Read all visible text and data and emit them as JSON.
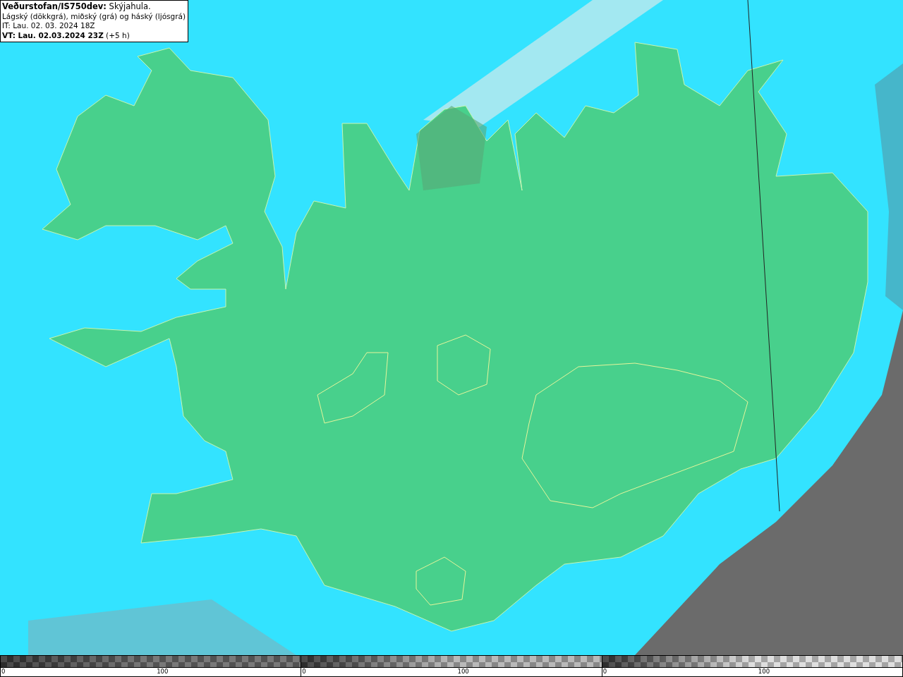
{
  "info_box": {
    "lines": [
      "**Veðurstofan/IS750dev:** Skýjahula.",
      "Lágský (dökkgrá), miðský (grá) og háský (ljósgrá)",
      "IT: Lau. 02. 03. 2024 18Z",
      "**VT: Lau. 02.03.2024 23Z** (+5 h)"
    ]
  },
  "legend": {
    "scales": [
      {
        "color": "#6e6e6e",
        "ticks": [
          "0",
          "100"
        ]
      },
      {
        "color": "#b4b4b4",
        "ticks": [
          "0",
          "100"
        ]
      },
      {
        "color": "#dcdcdc",
        "ticks": [
          "0",
          "100"
        ]
      }
    ]
  }
}
